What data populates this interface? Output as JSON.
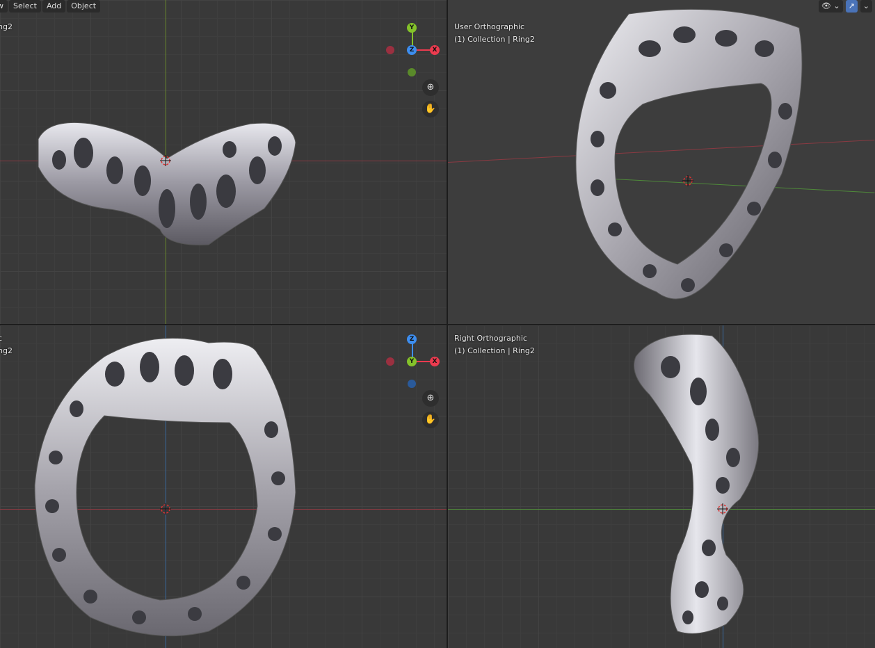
{
  "menu": {
    "view_label": "w",
    "select_label": "Select",
    "add_label": "Add",
    "object_label": "Object"
  },
  "viewports": {
    "top_left": {
      "view_name": "",
      "collection_line": "ing2"
    },
    "top_right": {
      "view_name": "User Orthographic",
      "collection_line": "(1) Collection | Ring2"
    },
    "bottom_left": {
      "view_name": "ic",
      "collection_line": "ing2"
    },
    "bottom_right": {
      "view_name": "Right Orthographic",
      "collection_line": "(1) Collection | Ring2"
    }
  },
  "gizmo_top": {
    "up_label": "Y",
    "center_label": "Z",
    "right_label": "X"
  },
  "gizmo_bottom": {
    "up_label": "Z",
    "center_label": "Y",
    "right_label": "X"
  },
  "icons": {
    "zoom": "magnifier-plus-icon",
    "pan": "hand-icon",
    "visibility": "eye-icon",
    "gizmo_toggle": "gizmo-icon"
  },
  "colors": {
    "axis_x": "#ec3b4f",
    "axis_y": "#84c22a",
    "axis_z": "#3d8ef0",
    "accent": "#4a73b8"
  }
}
